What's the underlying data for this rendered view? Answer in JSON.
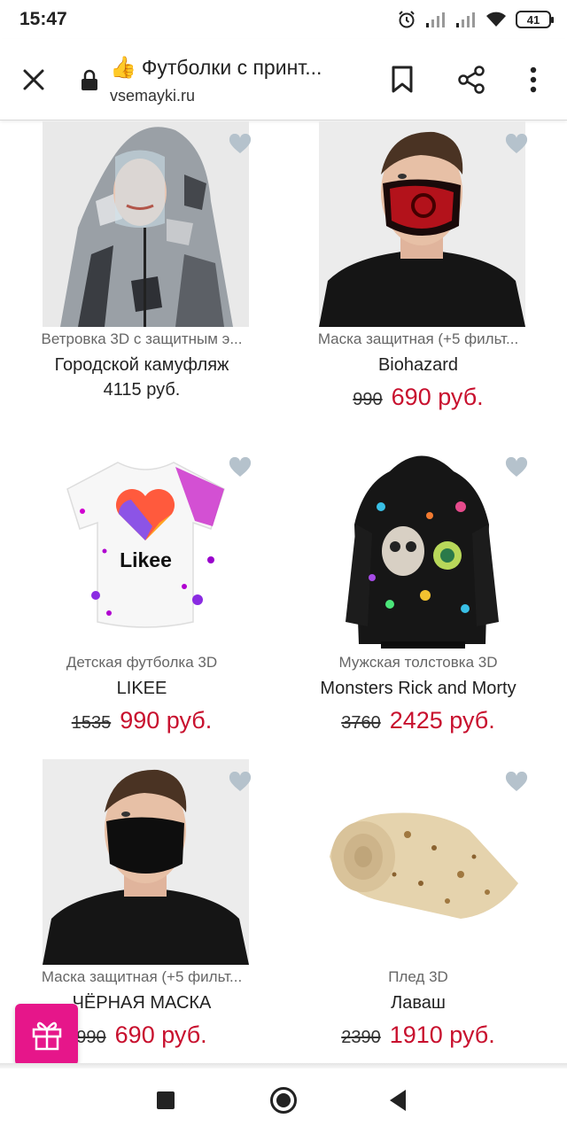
{
  "status_bar": {
    "time": "15:47",
    "battery": "41",
    "icons": [
      "alarm-icon",
      "signal-icon",
      "signal-icon",
      "wifi-icon",
      "battery-icon"
    ]
  },
  "browser": {
    "title_emoji": "👍",
    "title": "Футболки с принт...",
    "url": "vsemayki.ru",
    "icons": [
      "close-icon",
      "lock-icon",
      "bookmark-icon",
      "share-icon",
      "more-vert-icon"
    ]
  },
  "colors": {
    "sale_price": "#c8102e",
    "gift_button": "#e6168a",
    "favorite_heart": "#b5c2cc"
  },
  "products": [
    {
      "category": "Ветровка 3D с защитным э...",
      "name": "Городской камуфляж",
      "old_price": "",
      "price": "4115 руб.",
      "image": "camouflage-windbreaker-with-face-shield"
    },
    {
      "category": "Маска защитная (+5 фильт...",
      "name": "Biohazard",
      "old_price": "990",
      "price": "690 руб.",
      "image": "man-wearing-red-biohazard-mask"
    },
    {
      "category": "Детская футболка 3D",
      "name": "LIKEE",
      "old_price": "1535",
      "price": "990 руб.",
      "image": "white-tshirt-likee-heart-logo"
    },
    {
      "category": "Мужская толстовка 3D",
      "name": "Monsters Rick and Morty",
      "old_price": "3760",
      "price": "2425 руб.",
      "image": "black-hoodie-colorful-monsters-print"
    },
    {
      "category": "Маска защитная (+5 фильт...",
      "name": "ЧЁРНАЯ МАСКА",
      "old_price": "990",
      "price": "690 руб.",
      "image": "man-wearing-black-mask"
    },
    {
      "category": "Плед 3D",
      "name": "Лаваш",
      "old_price": "2390",
      "price": "1910 руб.",
      "image": "lavash-printed-blanket"
    }
  ],
  "likee_logo_text": "Likee"
}
